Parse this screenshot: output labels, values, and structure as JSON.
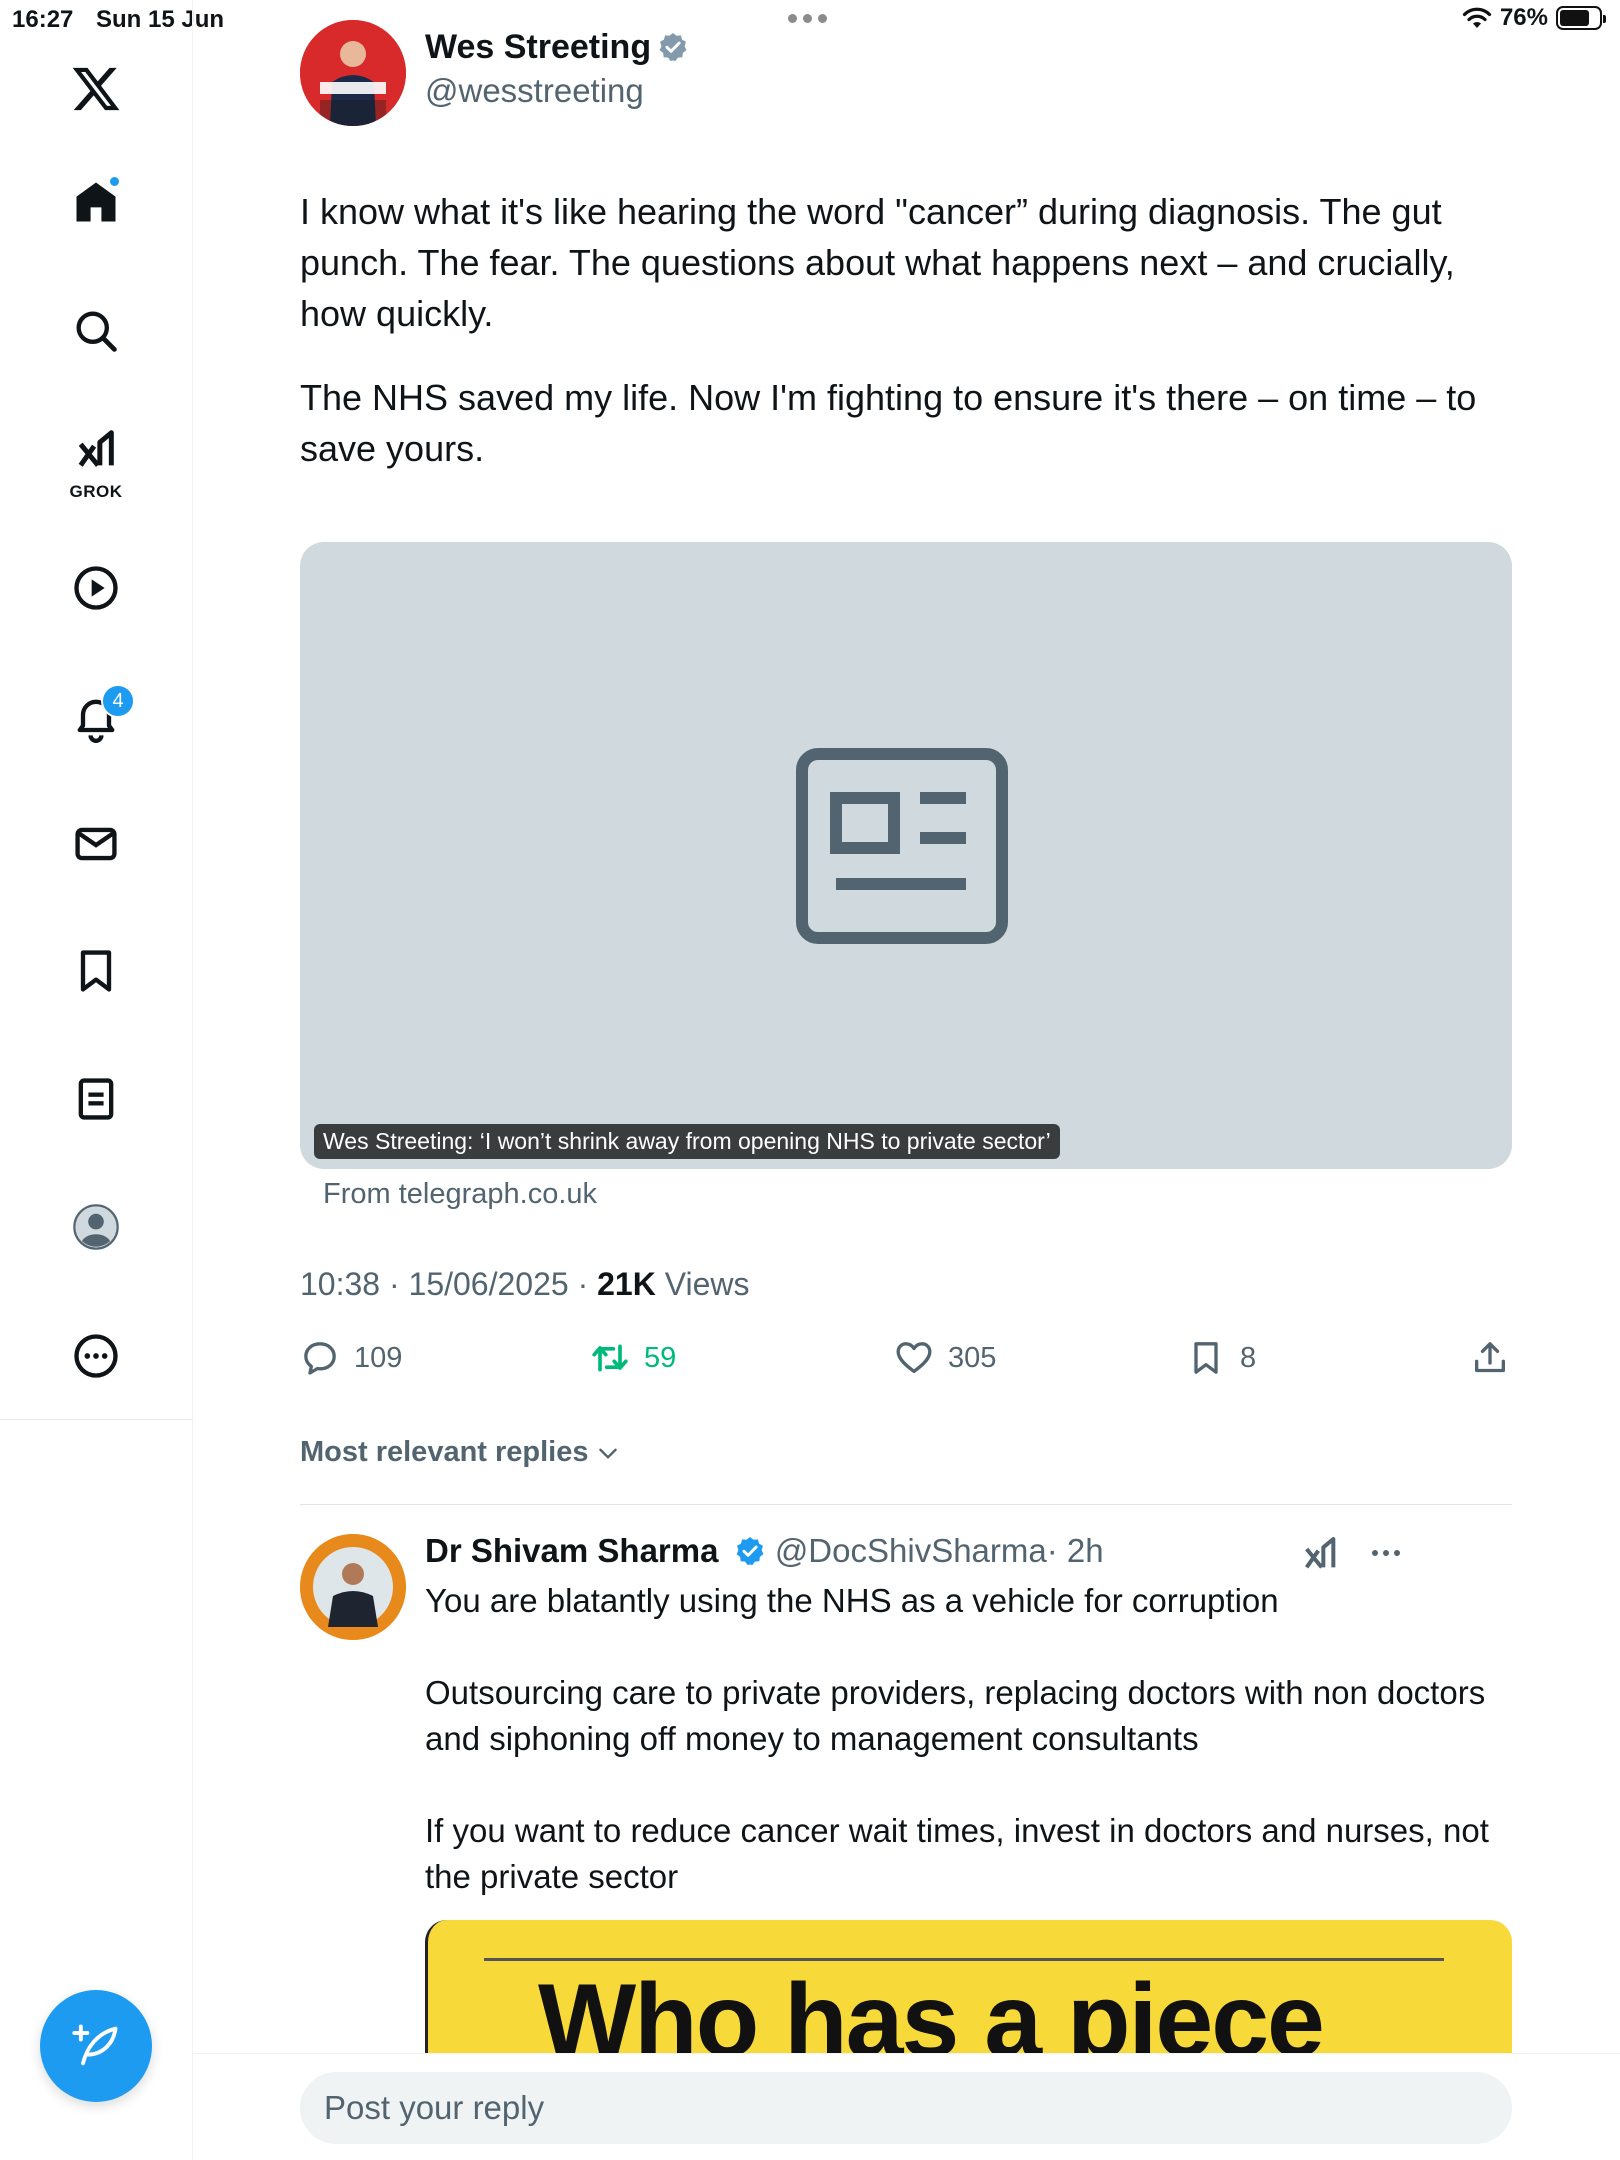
{
  "status_bar": {
    "time": "16:27",
    "date": "Sun 15 Jun",
    "battery": "76%",
    "battery_level": 0.76
  },
  "sidebar": {
    "items": [
      {
        "name": "x-logo",
        "icon": "x-logo-icon"
      },
      {
        "name": "home",
        "icon": "home-icon",
        "has_dot": true
      },
      {
        "name": "explore",
        "icon": "search-icon"
      },
      {
        "name": "grok",
        "icon": "grok-icon",
        "label": "GROK"
      },
      {
        "name": "videos",
        "icon": "play-icon"
      },
      {
        "name": "notifications",
        "icon": "bell-icon",
        "badge": "4"
      },
      {
        "name": "messages",
        "icon": "envelope-icon"
      },
      {
        "name": "bookmarks",
        "icon": "bookmark-icon"
      },
      {
        "name": "lists",
        "icon": "list-icon"
      },
      {
        "name": "profile",
        "icon": "profile-icon"
      },
      {
        "name": "more",
        "icon": "more-icon"
      }
    ],
    "compose_icon": "compose-icon"
  },
  "tweet": {
    "author_name": "Wes Streeting",
    "author_handle": "@wesstreeting",
    "paragraphs": [
      "I know what it's like hearing the word \"cancer” during diagnosis. The gut punch. The fear. The questions about what happens next – and crucially, how quickly.",
      "The NHS saved my life. Now I'm fighting to ensure it's there – on time – to save yours."
    ],
    "card_caption": "Wes Streeting: ‘I won’t shrink away from opening NHS to private sector’",
    "card_source": "From telegraph.co.uk",
    "timestamp": "10:38 · 15/06/2025 · ",
    "views_count": "21K",
    "views_label": " Views",
    "actions": {
      "replies": "109",
      "retweets": "59",
      "likes": "305",
      "bookmarks": "8"
    }
  },
  "replies_sort_label": "Most relevant replies",
  "reply": {
    "author_name": "Dr Shivam Sharma",
    "author_handle": "@DocShivSharma",
    "time": "· 2h",
    "paragraphs": [
      "You are blatantly using the NHS as a vehicle for corruption",
      "Outsourcing care to private providers, replacing doctors with non doctors and siphoning off money to management consultants",
      "If you want to reduce cancer wait times, invest in doctors and nurses, not the private sector"
    ],
    "image_headline": "Who has a piece"
  },
  "reply_input": {
    "placeholder": "Post your reply"
  },
  "colors": {
    "accent": "#1d9bf0",
    "retweet": "#00ba7c",
    "secondary_text": "#536471",
    "card_bg": "#cfd9de"
  }
}
